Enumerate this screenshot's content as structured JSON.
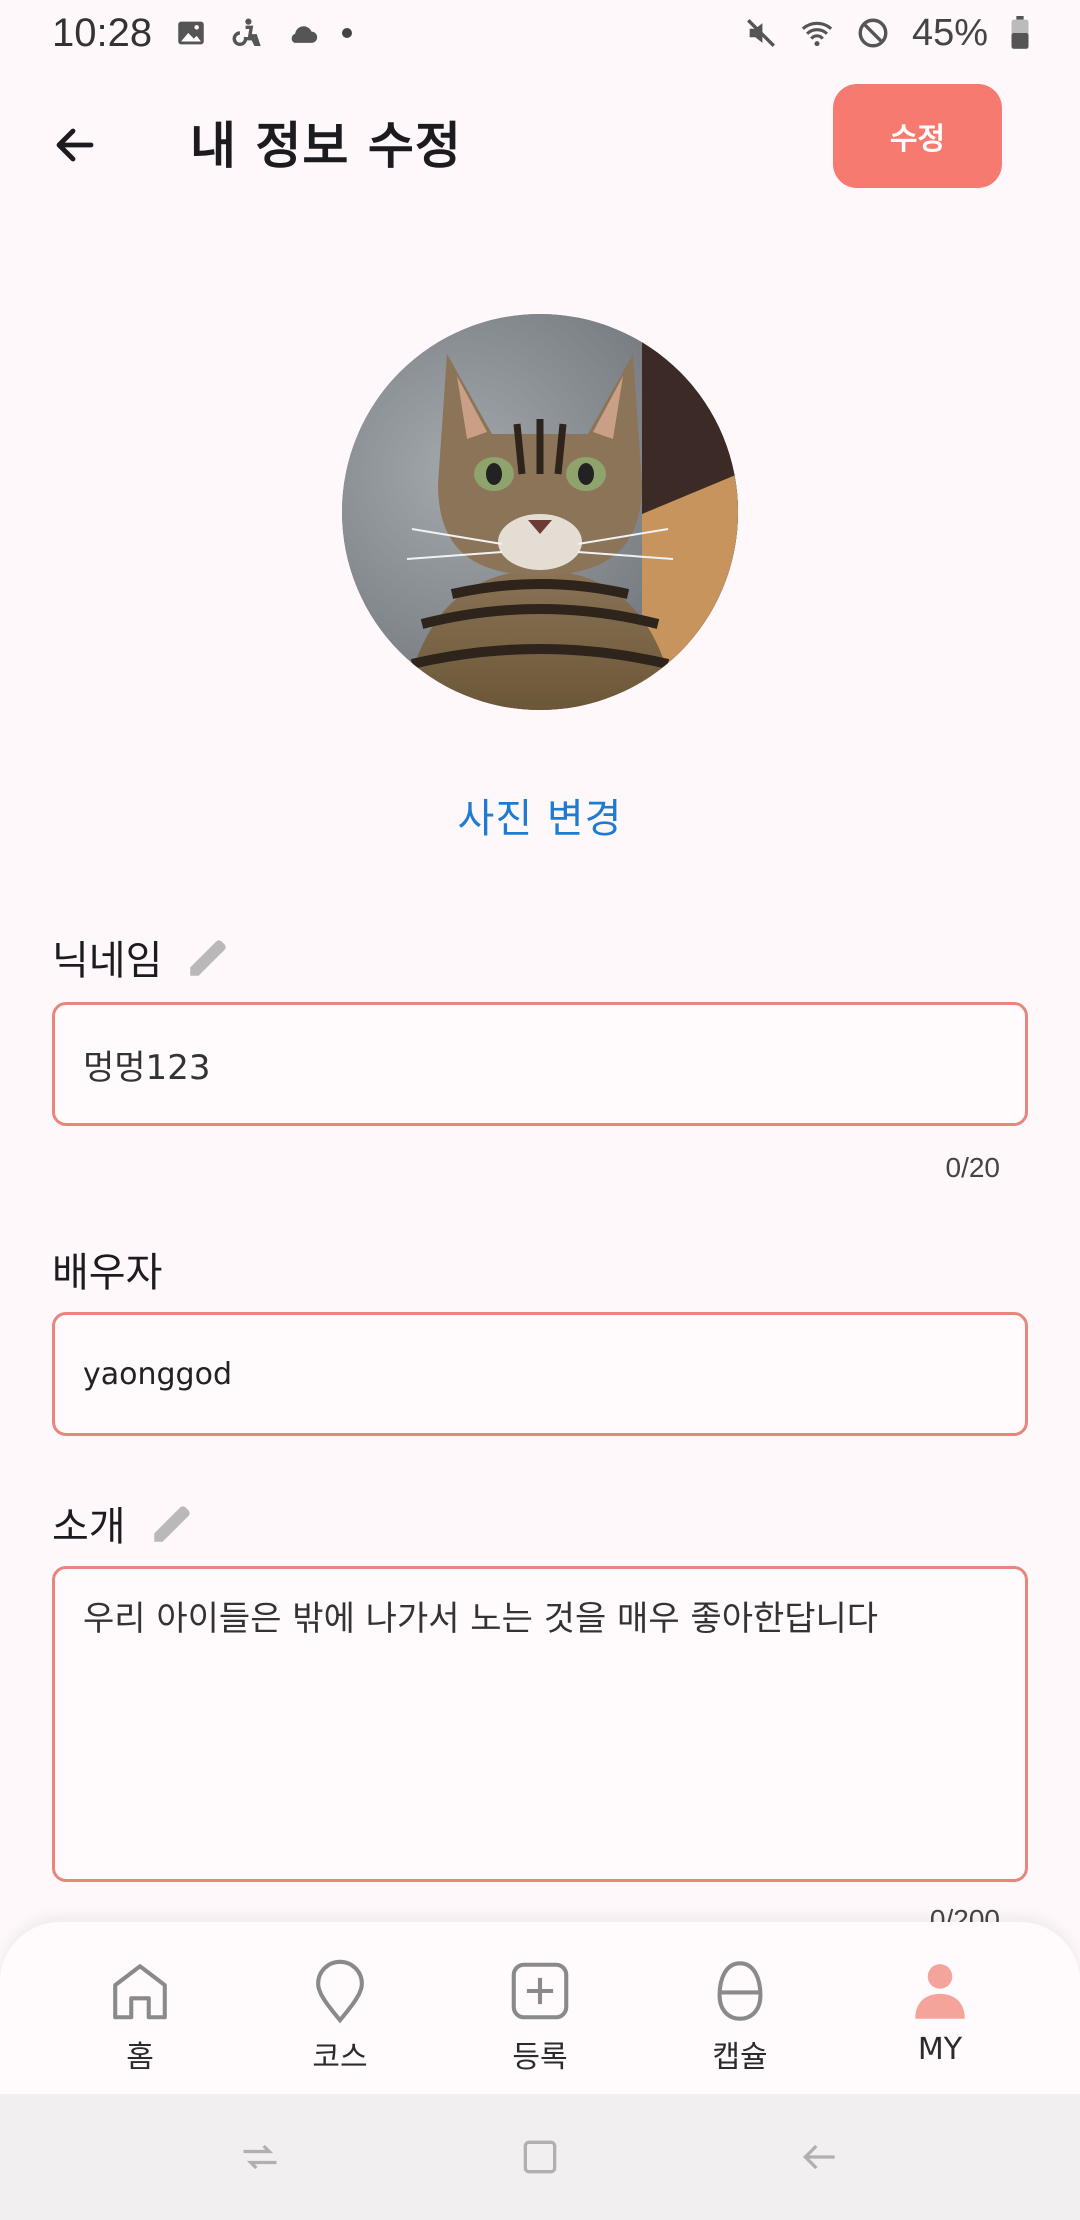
{
  "status_bar": {
    "time": "10:28",
    "battery": "45%",
    "icons": [
      "image-icon",
      "accessibility-icon",
      "cloud-icon",
      "dot-icon",
      "mute-icon",
      "wifi-icon",
      "do-not-disturb-icon",
      "battery-icon"
    ]
  },
  "header": {
    "title": "내 정보 수정",
    "edit_label": "수정"
  },
  "profile": {
    "change_photo_label": "사진 변경"
  },
  "nickname": {
    "label": "닉네임",
    "value": "멍멍123",
    "counter": "0/20"
  },
  "spouse": {
    "label": "배우자",
    "value": "yaonggod"
  },
  "intro": {
    "label": "소개",
    "value": "우리 아이들은 밖에 나가서 노는 것을 매우 좋아한답니다",
    "counter": "0/200"
  },
  "bottom_nav": {
    "items": [
      {
        "label": "홈",
        "icon": "home-icon"
      },
      {
        "label": "코스",
        "icon": "location-pin-icon"
      },
      {
        "label": "등록",
        "icon": "add-box-icon"
      },
      {
        "label": "캡슐",
        "icon": "capsule-icon"
      },
      {
        "label": "MY",
        "icon": "person-icon"
      }
    ],
    "active_index": 4,
    "active_color": "#f67a6f"
  },
  "colors": {
    "accent": "#f67a6f",
    "link": "#1f7bd1",
    "field_border": "#e8857c"
  }
}
